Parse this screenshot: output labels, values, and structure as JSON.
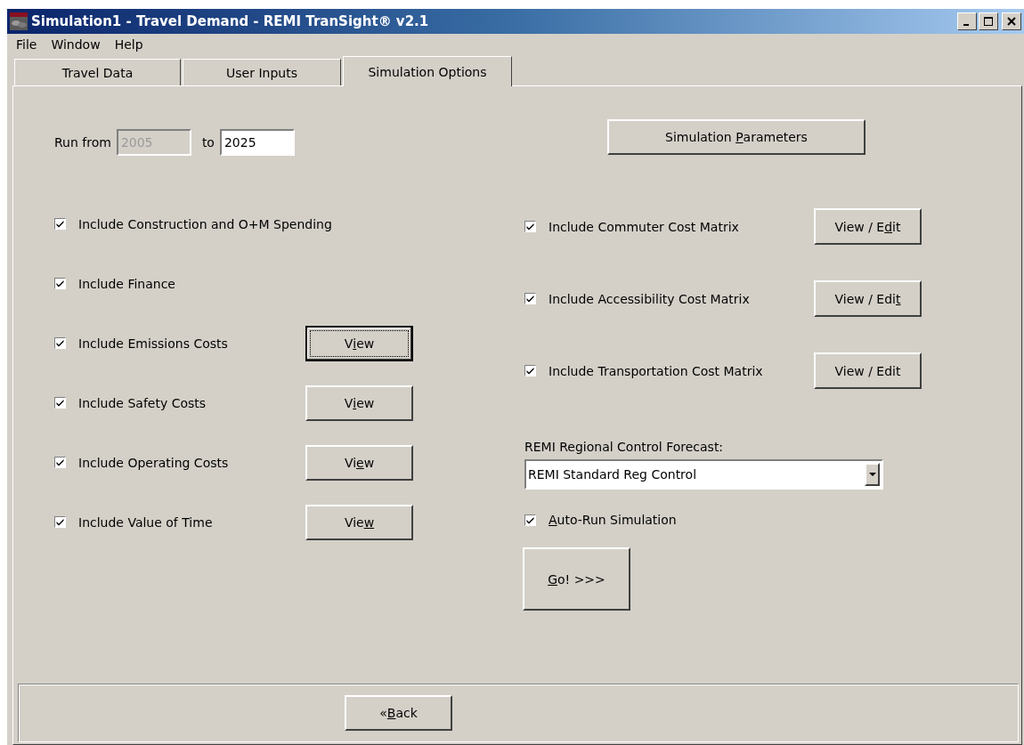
{
  "window": {
    "title": "Simulation1 - Travel Demand - REMI TranSight® v2.1"
  },
  "menu": [
    "File",
    "Window",
    "Help"
  ],
  "tabs": [
    {
      "label": "Travel Data",
      "selected": false
    },
    {
      "label": "User Inputs",
      "selected": false
    },
    {
      "label": "Simulation Options",
      "selected": true
    }
  ],
  "run": {
    "label": "Run from",
    "from": {
      "value": "2005",
      "disabled": true
    },
    "to_label": "to",
    "to": {
      "value": "2025",
      "disabled": false
    }
  },
  "simulation_parameters_button": {
    "label": [
      {
        "text": "Simulation ",
        "underlined": false
      },
      {
        "text": "P",
        "underlined": true
      },
      {
        "text": "arameters",
        "underlined": false
      }
    ]
  },
  "left_options": [
    {
      "label": "Include Construction and O+M Spending",
      "checked": true
    },
    {
      "label": "Include Finance",
      "checked": true
    },
    {
      "label": "Include Emissions Costs",
      "checked": true,
      "button": {
        "focused": true,
        "label": [
          {
            "text": "V",
            "underlined": false
          },
          {
            "text": "i",
            "underlined": true
          },
          {
            "text": "ew",
            "underlined": false
          }
        ]
      }
    },
    {
      "label": "Include Safety Costs",
      "checked": true,
      "button": {
        "focused": false,
        "label": [
          {
            "text": "V",
            "underlined": false
          },
          {
            "text": "i",
            "underlined": true
          },
          {
            "text": "ew",
            "underlined": false
          }
        ]
      }
    },
    {
      "label": "Include Operating Costs",
      "checked": true,
      "button": {
        "focused": false,
        "label": [
          {
            "text": "Vi",
            "underlined": false
          },
          {
            "text": "e",
            "underlined": true
          },
          {
            "text": "w",
            "underlined": false
          }
        ]
      }
    },
    {
      "label": "Include Value of Time",
      "checked": true,
      "button": {
        "focused": false,
        "label": [
          {
            "text": "Vie",
            "underlined": false
          },
          {
            "text": "w",
            "underlined": true
          }
        ]
      }
    }
  ],
  "right_options": [
    {
      "label": "Include Commuter Cost Matrix",
      "checked": true,
      "button": {
        "focused": false,
        "label": [
          {
            "text": "View / E",
            "underlined": false
          },
          {
            "text": "d",
            "underlined": true
          },
          {
            "text": "it",
            "underlined": false
          }
        ]
      }
    },
    {
      "label": "Include Accessibility Cost Matrix",
      "checked": true,
      "button": {
        "focused": false,
        "label": [
          {
            "text": "View / Edi",
            "underlined": false
          },
          {
            "text": "t",
            "underlined": true
          }
        ]
      }
    },
    {
      "label": "Include Transportation Cost Matrix",
      "checked": true,
      "button": {
        "focused": false,
        "label": [
          {
            "text": "View / Edit",
            "underlined": false
          }
        ]
      }
    }
  ],
  "forecast": {
    "label": "REMI Regional Control Forecast:",
    "value": "REMI Standard Reg Control"
  },
  "auto_run": {
    "checked": true,
    "label": [
      {
        "text": "A",
        "underlined": true
      },
      {
        "text": "uto-Run Simulation",
        "underlined": false
      }
    ]
  },
  "go_button": {
    "label": [
      {
        "text": "G",
        "underlined": true
      },
      {
        "text": "o! >>>",
        "underlined": false
      }
    ]
  },
  "back_button": {
    "label": [
      {
        "text": "«",
        "underlined": false
      },
      {
        "text": "B",
        "underlined": true
      },
      {
        "text": "ack",
        "underlined": false
      }
    ]
  }
}
